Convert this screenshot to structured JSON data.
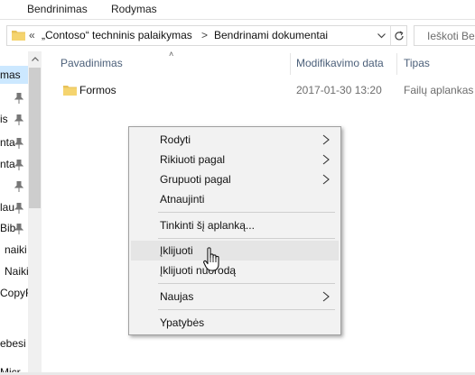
{
  "ribbon": {
    "tabs": [
      "Bendrinimas",
      "Rodymas"
    ]
  },
  "address": {
    "overflow_glyph": "«",
    "breadcrumb": [
      "„Contoso“ techninis palaikymas",
      "Bendrinami dokumentai"
    ],
    "separator": ">",
    "search_placeholder": "Ieškoti Ben"
  },
  "nav": {
    "items": [
      "mas",
      "",
      "is",
      "nta",
      "nta",
      "",
      "lau",
      "Bib",
      "naiki",
      "Naiki",
      "CopyF",
      "",
      "ebesi",
      "Micr"
    ]
  },
  "columns": {
    "name": "Pavadinimas",
    "modified": "Modifikavimo data",
    "type": "Tipas"
  },
  "files": [
    {
      "name": "Formos",
      "modified": "2017-01-30 13:20",
      "type": "Failų aplankas"
    }
  ],
  "context_menu": {
    "items": [
      {
        "label": "Rodyti",
        "submenu": true
      },
      {
        "label": "Rikiuoti pagal",
        "submenu": true
      },
      {
        "label": "Grupuoti pagal",
        "submenu": true
      },
      {
        "label": "Atnaujinti",
        "submenu": false
      },
      {
        "label": "Tinkinti šį aplanką...",
        "submenu": false
      },
      {
        "label": "Įklijuoti",
        "submenu": false,
        "highlighted": true
      },
      {
        "label": "Įklijuoti nuorodą",
        "submenu": false
      },
      {
        "label": "Naujas",
        "submenu": true
      },
      {
        "label": "Ypatybės",
        "submenu": false
      }
    ]
  },
  "colors": {
    "nav_selected": "#cce8ff",
    "folder": "#e8c25a",
    "header_text": "#4c607a",
    "menu_bg": "#f2f2f2",
    "menu_hover": "#e5e5e5"
  },
  "icons": {
    "folder": "folder-icon",
    "pin": "pin-icon",
    "refresh": "refresh-icon",
    "chevron": "chevron-down-icon",
    "submenu": "chevron-right-icon",
    "cursor": "hand-pointer-icon"
  }
}
